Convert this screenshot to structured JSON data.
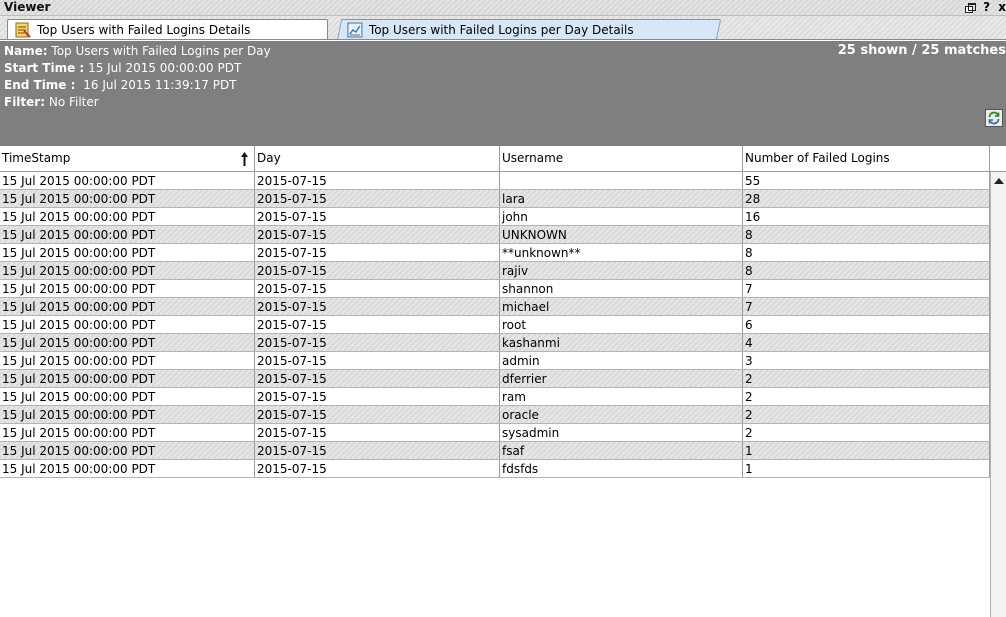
{
  "window": {
    "title": "Viewer",
    "help_label": "?",
    "close_label": "x"
  },
  "tabs": [
    {
      "label": "Top Users with Failed Logins Details",
      "icon": "report-icon",
      "active": false
    },
    {
      "label": "Top Users with Failed Logins per Day Details",
      "icon": "chart-report-icon",
      "active": true
    }
  ],
  "info": {
    "name_label": "Name:",
    "name_value": "Top Users with Failed Logins per Day",
    "start_label": "Start Time :",
    "start_value": "15 Jul 2015 00:00:00 PDT",
    "end_label": "End Time :",
    "end_value": "16 Jul 2015 11:39:17 PDT",
    "filter_label": "Filter:",
    "filter_value": "No Filter",
    "count": "25 shown / 25 matches"
  },
  "columns": [
    "TimeStamp",
    "Day",
    "Username",
    "Number of Failed Logins"
  ],
  "rows": [
    [
      "15 Jul 2015 00:00:00 PDT",
      "2015-07-15",
      "",
      "55"
    ],
    [
      "15 Jul 2015 00:00:00 PDT",
      "2015-07-15",
      "lara",
      "28"
    ],
    [
      "15 Jul 2015 00:00:00 PDT",
      "2015-07-15",
      "john",
      "16"
    ],
    [
      "15 Jul 2015 00:00:00 PDT",
      "2015-07-15",
      "UNKNOWN",
      "8"
    ],
    [
      "15 Jul 2015 00:00:00 PDT",
      "2015-07-15",
      "**unknown**",
      "8"
    ],
    [
      "15 Jul 2015 00:00:00 PDT",
      "2015-07-15",
      "rajiv",
      "8"
    ],
    [
      "15 Jul 2015 00:00:00 PDT",
      "2015-07-15",
      "shannon",
      "7"
    ],
    [
      "15 Jul 2015 00:00:00 PDT",
      "2015-07-15",
      "michael",
      "7"
    ],
    [
      "15 Jul 2015 00:00:00 PDT",
      "2015-07-15",
      "root",
      "6"
    ],
    [
      "15 Jul 2015 00:00:00 PDT",
      "2015-07-15",
      "kashanmi",
      "4"
    ],
    [
      "15 Jul 2015 00:00:00 PDT",
      "2015-07-15",
      "admin",
      "3"
    ],
    [
      "15 Jul 2015 00:00:00 PDT",
      "2015-07-15",
      "dferrier",
      "2"
    ],
    [
      "15 Jul 2015 00:00:00 PDT",
      "2015-07-15",
      "ram",
      "2"
    ],
    [
      "15 Jul 2015 00:00:00 PDT",
      "2015-07-15",
      "oracle",
      "2"
    ],
    [
      "15 Jul 2015 00:00:00 PDT",
      "2015-07-15",
      "sysadmin",
      "2"
    ],
    [
      "15 Jul 2015 00:00:00 PDT",
      "2015-07-15",
      "fsaf",
      "1"
    ],
    [
      "15 Jul 2015 00:00:00 PDT",
      "2015-07-15",
      "fdsfds",
      "1"
    ]
  ],
  "sort": {
    "column": "TimeStamp",
    "direction": "ascending"
  }
}
